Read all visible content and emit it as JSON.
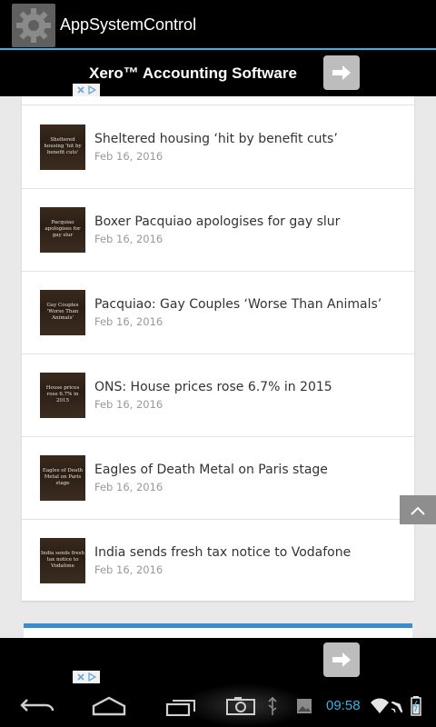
{
  "app": {
    "title": "AppSystemControl"
  },
  "ad_top": {
    "title": "Xero™ Accounting Software"
  },
  "articles": [
    {
      "title": "Sheltered housing ‘hit by benefit cuts’",
      "date": "Feb 16, 2016",
      "thumb_text": "Sheltered housing 'hit by benefit cuts'"
    },
    {
      "title": "Boxer Pacquiao apologises for gay slur",
      "date": "Feb 16, 2016",
      "thumb_text": "Pacquiao apologises for gay slur"
    },
    {
      "title": "Pacquiao: Gay Couples ‘Worse Than Animals’",
      "date": "Feb 16, 2016",
      "thumb_text": "Gay Couples 'Worse Than Animals'"
    },
    {
      "title": "ONS: House prices rose 6.7% in 2015",
      "date": "Feb 16, 2016",
      "thumb_text": "House prices rose 6.7% in 2015"
    },
    {
      "title": "Eagles of Death Metal on Paris stage",
      "date": "Feb 16, 2016",
      "thumb_text": "Eagles of Death Metal on Paris stage"
    },
    {
      "title": "India sends fresh tax notice to Vodafone",
      "date": "Feb 16, 2016",
      "thumb_text": "India sends fresh tax notice to Vodafone"
    }
  ],
  "status": {
    "time": "09:58"
  },
  "colors": {
    "accent": "#33b5e5",
    "section_bar": "#3b8ccc"
  },
  "icons": {
    "app": "gear-icon",
    "ad_arrow": "arrow-right-icon",
    "scroll_top": "chevron-up-icon",
    "nav": [
      "back-icon",
      "home-icon",
      "recent-apps-icon",
      "screenshot-icon",
      "usb-icon",
      "gallery-icon",
      "wifi-icon",
      "airplane-icon",
      "battery-icon"
    ]
  }
}
